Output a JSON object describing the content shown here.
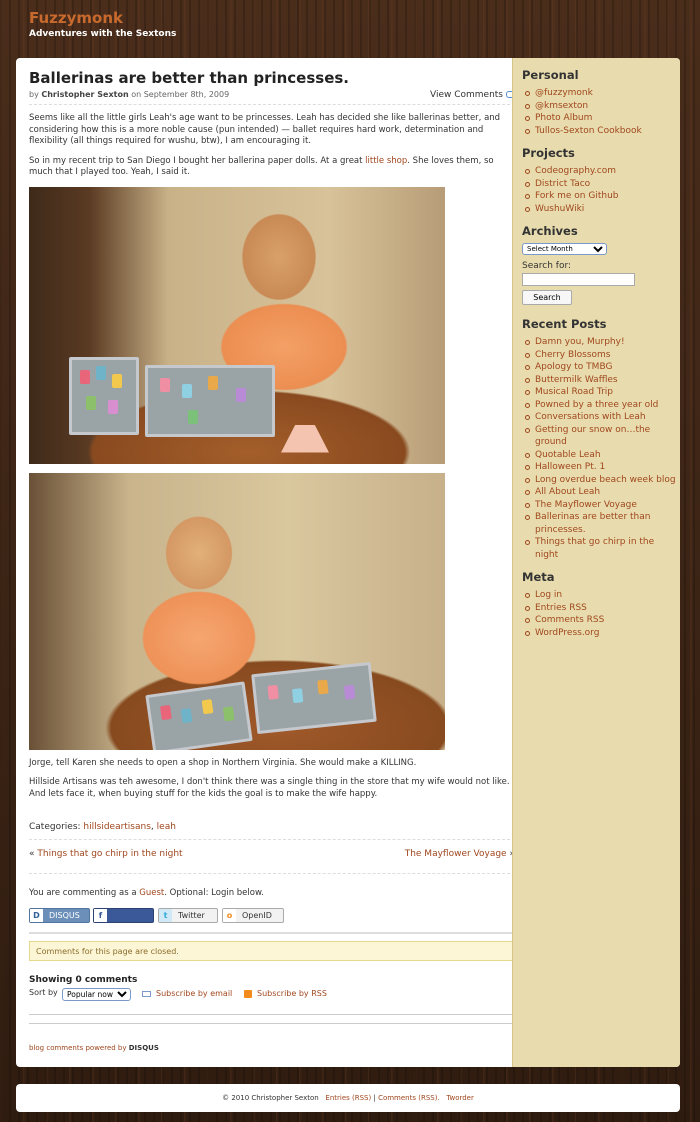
{
  "site": {
    "title": "Fuzzymonk",
    "tagline": "Adventures with the Sextons"
  },
  "post": {
    "title": "Ballerinas are better than princesses.",
    "by": "by",
    "author": "Christopher Sexton",
    "date_prefix": "on September 8th, 2009",
    "view_comments": "View Comments",
    "p1": "Seems like all the little girls Leah's age want to be princesses. Leah has decided she like ballerinas better, and considering how this is a more noble cause (pun intended) — ballet requires hard work, determination and flexibility (all things required for wushu, btw), I am encouraging it.",
    "p2_before": "So in my recent trip to San Diego I bought her ballerina paper dolls. At a great ",
    "p2_link": "little shop",
    "p2_after": ". She loves them, so much that I played too. Yeah, I said it.",
    "p3": "Jorge, tell Karen she needs to open a shop in Northern Virginia. She would make a KILLING.",
    "p4": "Hillside Artisans was teh awesome, I don't think there was a single thing in the store that my wife would not like. And lets face it, when buying stuff for the kids the goal is to make the wife happy.",
    "categories_label": "Categories:",
    "category1": "hillsideartisans",
    "category_sep": ",",
    "category2": "leah",
    "prev_arrow": "«",
    "prev_link": "Things that go chirp in the night",
    "next_link": "The Mayflower Voyage",
    "next_arrow": "»"
  },
  "comments": {
    "commenting_prefix": "You are commenting as a ",
    "guest": "Guest",
    "commenting_suffix": ". Optional: Login below.",
    "login_buttons": [
      "DISQUS",
      "Connect",
      "Twitter",
      "OpenID"
    ],
    "closed": "Comments for this page are closed.",
    "showing": "Showing 0 comments",
    "sort_by": "Sort by",
    "sort_value": "Popular now",
    "subscribe_email": "Subscribe by email",
    "subscribe_rss": "Subscribe by RSS",
    "powered_prefix": "blog comments powered by ",
    "powered_brand": "DISQUS"
  },
  "sidebar": {
    "personal_title": "Personal",
    "personal": [
      "@fuzzymonk",
      "@kmsexton",
      "Photo Album",
      "Tullos-Sexton Cookbook"
    ],
    "projects_title": "Projects",
    "projects": [
      "Codeography.com",
      "District Taco",
      "Fork me on Github",
      "WushuWiki"
    ],
    "archives_title": "Archives",
    "archives_select": "Select Month",
    "search_label": "Search for:",
    "search_button": "Search",
    "recent_title": "Recent Posts",
    "recent": [
      "Damn you, Murphy!",
      "Cherry Blossoms",
      "Apology to TMBG",
      "Buttermilk Waffles",
      "Musical Road Trip",
      "Powned by a three year old",
      "Conversations with Leah",
      "Getting our snow on…the ground",
      "Quotable Leah",
      "Halloween Pt. 1",
      "Long overdue beach week blog",
      "All About Leah",
      "The Mayflower Voyage",
      "Ballerinas are better than princesses.",
      "Things that go chirp in the night"
    ],
    "meta_title": "Meta",
    "meta": [
      "Log in",
      "Entries RSS",
      "Comments RSS",
      "WordPress.org"
    ]
  },
  "footer": {
    "copyright": "© 2010 Christopher Sexton",
    "entries": "Entries (RSS)",
    "sep": "|",
    "comments": "Comments (RSS).",
    "theme": "Tworder"
  }
}
